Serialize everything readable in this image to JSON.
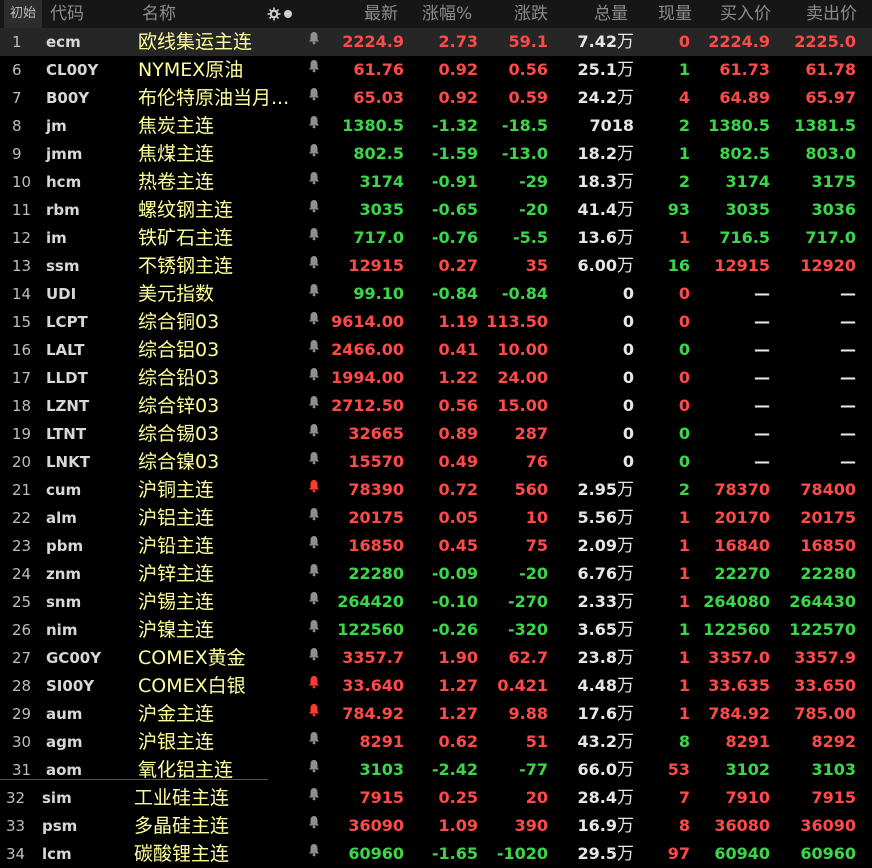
{
  "header": {
    "first": "初始",
    "code": "代码",
    "name": "名称",
    "last": "最新",
    "chg_pct": "涨幅%",
    "chg": "涨跌",
    "volume": "总量",
    "cur_vol": "现量",
    "bid": "买入价",
    "ask": "卖出价"
  },
  "colors": {
    "up": "#ff4a4a",
    "down": "#3cd64a",
    "name": "#ffff9a",
    "alert_bell": "#ff3b2f"
  },
  "rows": [
    {
      "idx": "1",
      "code": "ecm",
      "name": "欧线集运主连",
      "bell": "bell-icon",
      "last": "2224.9",
      "pct": "2.73",
      "chg": "59.1",
      "vol": "7.42",
      "wan": "万",
      "cur": "0",
      "bid": "2224.9",
      "ask": "2225.0",
      "dir": "up",
      "curdir": "up",
      "biddir": "up",
      "askdir": "up",
      "sel": true
    },
    {
      "idx": "6",
      "code": "CL00Y",
      "name": "NYMEX原油",
      "bell": "bell-icon",
      "last": "61.76",
      "pct": "0.92",
      "chg": "0.56",
      "vol": "25.1",
      "wan": "万",
      "cur": "1",
      "bid": "61.73",
      "ask": "61.78",
      "dir": "up",
      "curdir": "down",
      "biddir": "up",
      "askdir": "up"
    },
    {
      "idx": "7",
      "code": "B00Y",
      "name": "布伦特原油当月...",
      "bell": "bell-icon",
      "last": "65.03",
      "pct": "0.92",
      "chg": "0.59",
      "vol": "24.2",
      "wan": "万",
      "cur": "4",
      "bid": "64.89",
      "ask": "65.97",
      "dir": "up",
      "curdir": "up",
      "biddir": "up",
      "askdir": "up"
    },
    {
      "idx": "8",
      "code": "jm",
      "name": "焦炭主连",
      "bell": "bell-icon",
      "last": "1380.5",
      "pct": "-1.32",
      "chg": "-18.5",
      "vol": "7018",
      "wan": "",
      "cur": "2",
      "bid": "1380.5",
      "ask": "1381.5",
      "dir": "down",
      "curdir": "down",
      "biddir": "down",
      "askdir": "down"
    },
    {
      "idx": "9",
      "code": "jmm",
      "name": "焦煤主连",
      "bell": "bell-icon",
      "last": "802.5",
      "pct": "-1.59",
      "chg": "-13.0",
      "vol": "18.2",
      "wan": "万",
      "cur": "1",
      "bid": "802.5",
      "ask": "803.0",
      "dir": "down",
      "curdir": "down",
      "biddir": "down",
      "askdir": "down"
    },
    {
      "idx": "10",
      "code": "hcm",
      "name": "热卷主连",
      "bell": "bell-icon",
      "last": "3174",
      "pct": "-0.91",
      "chg": "-29",
      "vol": "18.3",
      "wan": "万",
      "cur": "2",
      "bid": "3174",
      "ask": "3175",
      "dir": "down",
      "curdir": "down",
      "biddir": "down",
      "askdir": "down"
    },
    {
      "idx": "11",
      "code": "rbm",
      "name": "螺纹钢主连",
      "bell": "bell-icon",
      "last": "3035",
      "pct": "-0.65",
      "chg": "-20",
      "vol": "41.4",
      "wan": "万",
      "cur": "93",
      "bid": "3035",
      "ask": "3036",
      "dir": "down",
      "curdir": "down",
      "biddir": "down",
      "askdir": "down"
    },
    {
      "idx": "12",
      "code": "im",
      "name": "铁矿石主连",
      "bell": "bell-icon",
      "last": "717.0",
      "pct": "-0.76",
      "chg": "-5.5",
      "vol": "13.6",
      "wan": "万",
      "cur": "1",
      "bid": "716.5",
      "ask": "717.0",
      "dir": "down",
      "curdir": "up",
      "biddir": "down",
      "askdir": "down"
    },
    {
      "idx": "13",
      "code": "ssm",
      "name": "不锈钢主连",
      "bell": "bell-icon",
      "last": "12915",
      "pct": "0.27",
      "chg": "35",
      "vol": "6.00",
      "wan": "万",
      "cur": "16",
      "bid": "12915",
      "ask": "12920",
      "dir": "up",
      "curdir": "down",
      "biddir": "up",
      "askdir": "up"
    },
    {
      "idx": "14",
      "code": "UDI",
      "name": "美元指数",
      "bell": "bell-icon",
      "last": "99.10",
      "pct": "-0.84",
      "chg": "-0.84",
      "vol": "0",
      "wan": "",
      "cur": "0",
      "bid": "—",
      "ask": "—",
      "dir": "down",
      "curdir": "up",
      "biddir": "white",
      "askdir": "white"
    },
    {
      "idx": "15",
      "code": "LCPT",
      "name": "综合铜03",
      "bell": "bell-icon",
      "last": "9614.00",
      "pct": "1.19",
      "chg": "113.50",
      "vol": "0",
      "wan": "",
      "cur": "0",
      "bid": "—",
      "ask": "—",
      "dir": "up",
      "curdir": "up",
      "biddir": "white",
      "askdir": "white"
    },
    {
      "idx": "16",
      "code": "LALT",
      "name": "综合铝03",
      "bell": "bell-icon",
      "last": "2466.00",
      "pct": "0.41",
      "chg": "10.00",
      "vol": "0",
      "wan": "",
      "cur": "0",
      "bid": "—",
      "ask": "—",
      "dir": "up",
      "curdir": "down",
      "biddir": "white",
      "askdir": "white"
    },
    {
      "idx": "17",
      "code": "LLDT",
      "name": "综合铅03",
      "bell": "bell-icon",
      "last": "1994.00",
      "pct": "1.22",
      "chg": "24.00",
      "vol": "0",
      "wan": "",
      "cur": "0",
      "bid": "—",
      "ask": "—",
      "dir": "up",
      "curdir": "up",
      "biddir": "white",
      "askdir": "white"
    },
    {
      "idx": "18",
      "code": "LZNT",
      "name": "综合锌03",
      "bell": "bell-icon",
      "last": "2712.50",
      "pct": "0.56",
      "chg": "15.00",
      "vol": "0",
      "wan": "",
      "cur": "0",
      "bid": "—",
      "ask": "—",
      "dir": "up",
      "curdir": "up",
      "biddir": "white",
      "askdir": "white"
    },
    {
      "idx": "19",
      "code": "LTNT",
      "name": "综合锡03",
      "bell": "bell-icon",
      "last": "32665",
      "pct": "0.89",
      "chg": "287",
      "vol": "0",
      "wan": "",
      "cur": "0",
      "bid": "—",
      "ask": "—",
      "dir": "up",
      "curdir": "down",
      "biddir": "white",
      "askdir": "white"
    },
    {
      "idx": "20",
      "code": "LNKT",
      "name": "综合镍03",
      "bell": "bell-icon",
      "last": "15570",
      "pct": "0.49",
      "chg": "76",
      "vol": "0",
      "wan": "",
      "cur": "0",
      "bid": "—",
      "ask": "—",
      "dir": "up",
      "curdir": "down",
      "biddir": "white",
      "askdir": "white"
    },
    {
      "idx": "21",
      "code": "cum",
      "name": "沪铜主连",
      "bell": "bell-alert-icon",
      "last": "78390",
      "pct": "0.72",
      "chg": "560",
      "vol": "2.95",
      "wan": "万",
      "cur": "2",
      "bid": "78370",
      "ask": "78400",
      "dir": "up",
      "curdir": "down",
      "biddir": "up",
      "askdir": "up"
    },
    {
      "idx": "22",
      "code": "alm",
      "name": "沪铝主连",
      "bell": "bell-icon",
      "last": "20175",
      "pct": "0.05",
      "chg": "10",
      "vol": "5.56",
      "wan": "万",
      "cur": "1",
      "bid": "20170",
      "ask": "20175",
      "dir": "up",
      "curdir": "up",
      "biddir": "up",
      "askdir": "up"
    },
    {
      "idx": "23",
      "code": "pbm",
      "name": "沪铅主连",
      "bell": "bell-icon",
      "last": "16850",
      "pct": "0.45",
      "chg": "75",
      "vol": "2.09",
      "wan": "万",
      "cur": "1",
      "bid": "16840",
      "ask": "16850",
      "dir": "up",
      "curdir": "up",
      "biddir": "up",
      "askdir": "up"
    },
    {
      "idx": "24",
      "code": "znm",
      "name": "沪锌主连",
      "bell": "bell-icon",
      "last": "22280",
      "pct": "-0.09",
      "chg": "-20",
      "vol": "6.76",
      "wan": "万",
      "cur": "1",
      "bid": "22270",
      "ask": "22280",
      "dir": "down",
      "curdir": "up",
      "biddir": "down",
      "askdir": "down"
    },
    {
      "idx": "25",
      "code": "snm",
      "name": "沪锡主连",
      "bell": "bell-icon",
      "last": "264420",
      "pct": "-0.10",
      "chg": "-270",
      "vol": "2.33",
      "wan": "万",
      "cur": "1",
      "bid": "264080",
      "ask": "264430",
      "dir": "down",
      "curdir": "up",
      "biddir": "down",
      "askdir": "down"
    },
    {
      "idx": "26",
      "code": "nim",
      "name": "沪镍主连",
      "bell": "bell-icon",
      "last": "122560",
      "pct": "-0.26",
      "chg": "-320",
      "vol": "3.65",
      "wan": "万",
      "cur": "1",
      "bid": "122560",
      "ask": "122570",
      "dir": "down",
      "curdir": "down",
      "biddir": "down",
      "askdir": "down"
    },
    {
      "idx": "27",
      "code": "GC00Y",
      "name": "COMEX黄金",
      "bell": "bell-icon",
      "last": "3357.7",
      "pct": "1.90",
      "chg": "62.7",
      "vol": "23.8",
      "wan": "万",
      "cur": "1",
      "bid": "3357.0",
      "ask": "3357.9",
      "dir": "up",
      "curdir": "up",
      "biddir": "up",
      "askdir": "up"
    },
    {
      "idx": "28",
      "code": "SI00Y",
      "name": "COMEX白银",
      "bell": "bell-alert-icon",
      "last": "33.640",
      "pct": "1.27",
      "chg": "0.421",
      "vol": "4.48",
      "wan": "万",
      "cur": "1",
      "bid": "33.635",
      "ask": "33.650",
      "dir": "up",
      "curdir": "up",
      "biddir": "up",
      "askdir": "up"
    },
    {
      "idx": "29",
      "code": "aum",
      "name": "沪金主连",
      "bell": "bell-alert-icon",
      "last": "784.92",
      "pct": "1.27",
      "chg": "9.88",
      "vol": "17.6",
      "wan": "万",
      "cur": "1",
      "bid": "784.92",
      "ask": "785.00",
      "dir": "up",
      "curdir": "up",
      "biddir": "up",
      "askdir": "up"
    },
    {
      "idx": "30",
      "code": "agm",
      "name": "沪银主连",
      "bell": "bell-icon",
      "last": "8291",
      "pct": "0.62",
      "chg": "51",
      "vol": "43.2",
      "wan": "万",
      "cur": "8",
      "bid": "8291",
      "ask": "8292",
      "dir": "up",
      "curdir": "down",
      "biddir": "up",
      "askdir": "up"
    },
    {
      "idx": "31",
      "code": "aom",
      "name": "氧化铝主连",
      "bell": "bell-icon",
      "last": "3103",
      "pct": "-2.42",
      "chg": "-77",
      "vol": "66.0",
      "wan": "万",
      "cur": "53",
      "bid": "3102",
      "ask": "3103",
      "dir": "down",
      "curdir": "up",
      "biddir": "down",
      "askdir": "down"
    },
    {
      "idx": "32",
      "code": "sim",
      "name": "工业硅主连",
      "bell": "bell-icon",
      "last": "7915",
      "pct": "0.25",
      "chg": "20",
      "vol": "28.4",
      "wan": "万",
      "cur": "7",
      "bid": "7910",
      "ask": "7915",
      "dir": "up",
      "curdir": "up",
      "biddir": "up",
      "askdir": "up"
    },
    {
      "idx": "33",
      "code": "psm",
      "name": "多晶硅主连",
      "bell": "bell-icon",
      "last": "36090",
      "pct": "1.09",
      "chg": "390",
      "vol": "16.9",
      "wan": "万",
      "cur": "8",
      "bid": "36080",
      "ask": "36090",
      "dir": "up",
      "curdir": "up",
      "biddir": "up",
      "askdir": "up"
    },
    {
      "idx": "34",
      "code": "lcm",
      "name": "碳酸锂主连",
      "bell": "bell-icon",
      "last": "60960",
      "pct": "-1.65",
      "chg": "-1020",
      "vol": "29.5",
      "wan": "万",
      "cur": "97",
      "bid": "60940",
      "ask": "60960",
      "dir": "down",
      "curdir": "up",
      "biddir": "down",
      "askdir": "down"
    }
  ]
}
